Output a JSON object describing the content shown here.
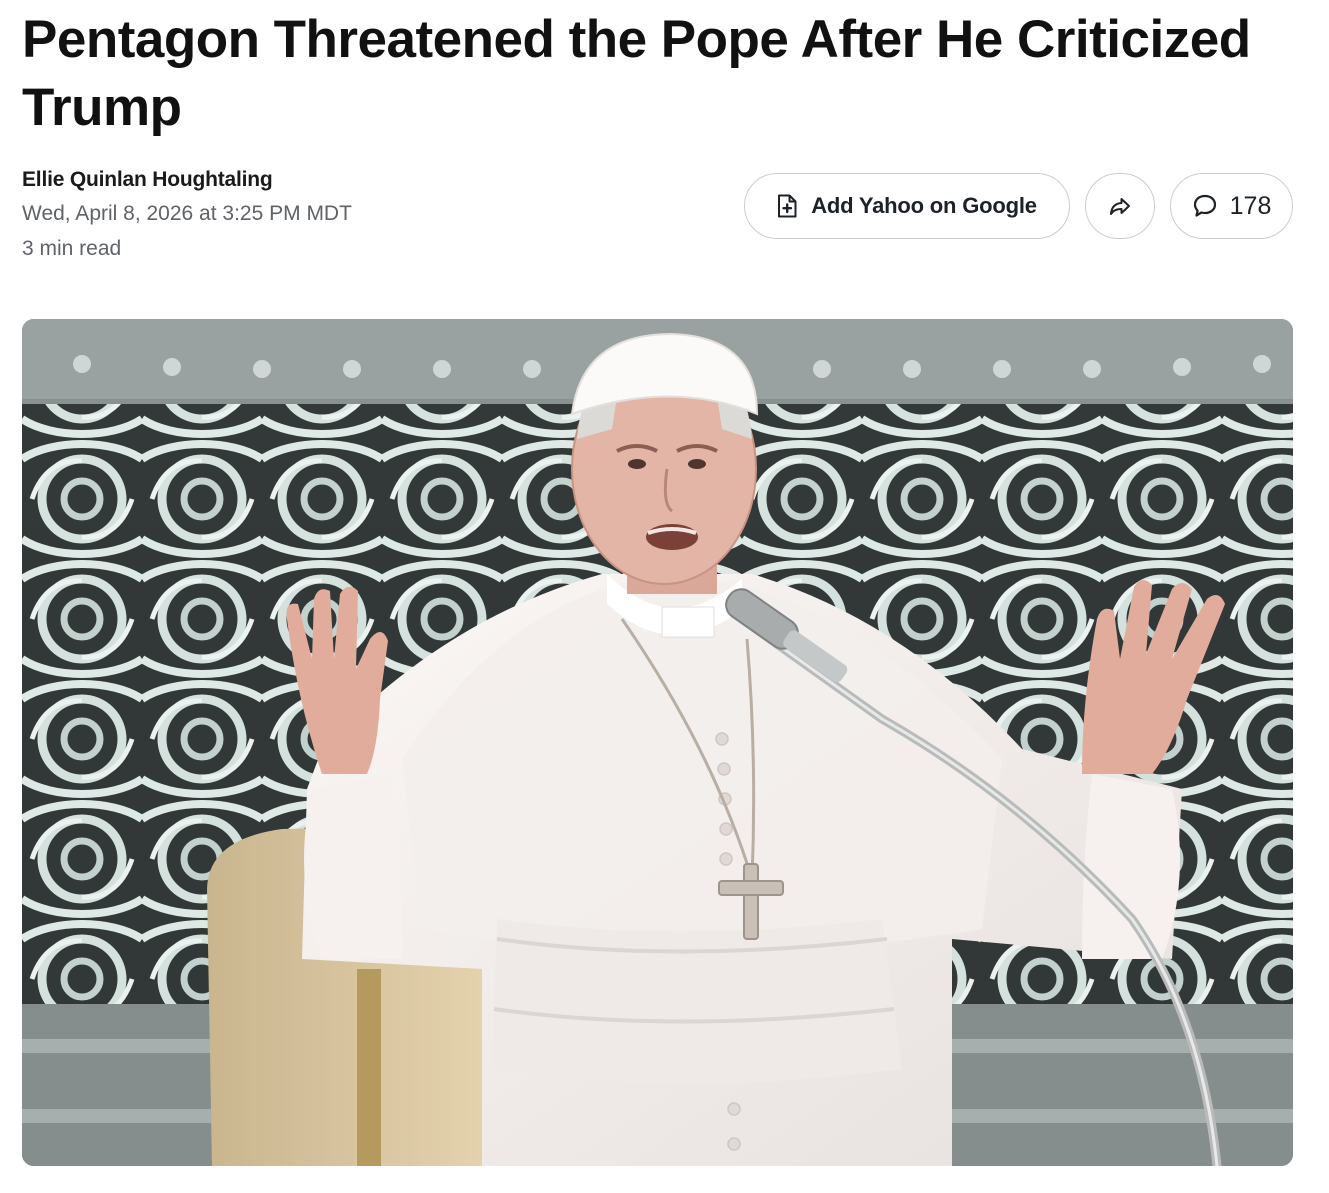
{
  "article": {
    "headline": "Pentagon Threatened the Pope After He Criticized Trump",
    "author": "Ellie Quinlan Houghtaling",
    "date": "Wed, April 8, 2026 at 3:25 PM MDT",
    "read_time": "3 min read"
  },
  "actions": {
    "add_source_label": "Add Yahoo on Google",
    "add_source_icon": "document-plus-icon",
    "share_icon": "share-arrow-icon",
    "comment_icon": "speech-bubble-icon",
    "comment_count": "178"
  },
  "colors": {
    "text": "#111111",
    "meta_text": "#5f6368",
    "pill_border": "#c9ccd1"
  }
}
